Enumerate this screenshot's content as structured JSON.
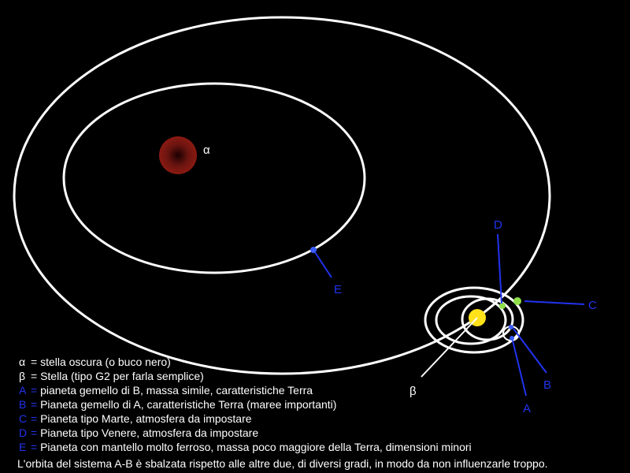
{
  "colors": {
    "background": "#000000",
    "orbit": "#ffffff",
    "pointer_blue": "#2233ee",
    "star_alpha": "#8a1a12",
    "star_beta": "#ffe21a",
    "planet_green": "#8ee04a",
    "planet_blue": "#3a5bff"
  },
  "labels": {
    "alpha": "α",
    "beta": "β",
    "A": "A",
    "B": "B",
    "C": "C",
    "D": "D",
    "E": "E"
  },
  "legend": [
    {
      "symbol": "α",
      "separator": "=",
      "text": "stella oscura (o buco nero)",
      "code_color": "white"
    },
    {
      "symbol": "β",
      "separator": "=",
      "text": "Stella (tipo G2 per farla semplice)",
      "code_color": "white"
    },
    {
      "symbol": "A",
      "separator": "=",
      "text": "pianeta gemello di B, massa simile, caratteristiche Terra",
      "code_color": "blue"
    },
    {
      "symbol": "B",
      "separator": "=",
      "text": "Pianeta gemello di A, caratteristiche Terra (maree importanti)",
      "code_color": "blue"
    },
    {
      "symbol": "C",
      "separator": "=",
      "text": "Pianeta tipo Marte, atmosfera da impostare",
      "code_color": "blue"
    },
    {
      "symbol": "D",
      "separator": "=",
      "text": "Pianeta tipo Venere, atmosfera da impostare",
      "code_color": "blue"
    },
    {
      "symbol": "E",
      "separator": "=",
      "text": "Pianeta con mantello molto ferroso, massa poco maggiore della Terra, dimensioni minori",
      "code_color": "blue"
    }
  ],
  "note": "L'orbita del sistema A-B è sbalzata rispetto alle altre due, di diversi gradi, in modo da non influenzarle troppo."
}
